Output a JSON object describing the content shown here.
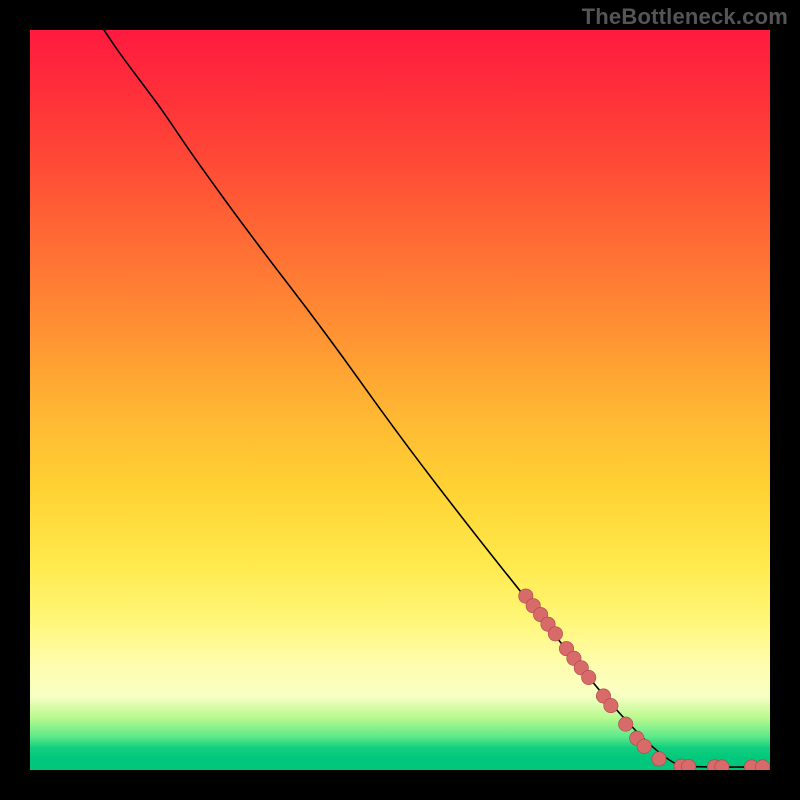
{
  "watermark_text": "TheBottleneck.com",
  "colors": {
    "background": "#000000",
    "curve": "#000000",
    "dot_fill": "#d86a6a",
    "dot_stroke": "#a94848"
  },
  "chart_data": {
    "type": "line",
    "title": "",
    "xlabel": "",
    "ylabel": "",
    "xlim": [
      0,
      100
    ],
    "ylim": [
      0,
      100
    ],
    "grid": false,
    "legend": false,
    "curve_points": [
      {
        "x": 10,
        "y": 100
      },
      {
        "x": 12,
        "y": 97
      },
      {
        "x": 15,
        "y": 93
      },
      {
        "x": 18,
        "y": 89
      },
      {
        "x": 22,
        "y": 83
      },
      {
        "x": 30,
        "y": 72
      },
      {
        "x": 40,
        "y": 59
      },
      {
        "x": 50,
        "y": 45
      },
      {
        "x": 60,
        "y": 32
      },
      {
        "x": 68,
        "y": 22
      },
      {
        "x": 75,
        "y": 13
      },
      {
        "x": 82,
        "y": 5
      },
      {
        "x": 86,
        "y": 1.5
      },
      {
        "x": 88,
        "y": 0.5
      },
      {
        "x": 92,
        "y": 0.4
      },
      {
        "x": 96,
        "y": 0.4
      },
      {
        "x": 100,
        "y": 0.4
      }
    ],
    "highlight_points": [
      {
        "x": 67,
        "y": 23.5
      },
      {
        "x": 68,
        "y": 22.2
      },
      {
        "x": 69,
        "y": 21.0
      },
      {
        "x": 70,
        "y": 19.7
      },
      {
        "x": 71,
        "y": 18.4
      },
      {
        "x": 72.5,
        "y": 16.4
      },
      {
        "x": 73.5,
        "y": 15.1
      },
      {
        "x": 74.5,
        "y": 13.8
      },
      {
        "x": 75.5,
        "y": 12.5
      },
      {
        "x": 77.5,
        "y": 10.0
      },
      {
        "x": 78.5,
        "y": 8.7
      },
      {
        "x": 80.5,
        "y": 6.2
      },
      {
        "x": 82.0,
        "y": 4.3
      },
      {
        "x": 83.0,
        "y": 3.2
      },
      {
        "x": 85.0,
        "y": 1.5
      },
      {
        "x": 88.0,
        "y": 0.5
      },
      {
        "x": 89.0,
        "y": 0.45
      },
      {
        "x": 92.5,
        "y": 0.42
      },
      {
        "x": 93.5,
        "y": 0.41
      },
      {
        "x": 97.5,
        "y": 0.4
      },
      {
        "x": 99.0,
        "y": 0.4
      }
    ]
  }
}
